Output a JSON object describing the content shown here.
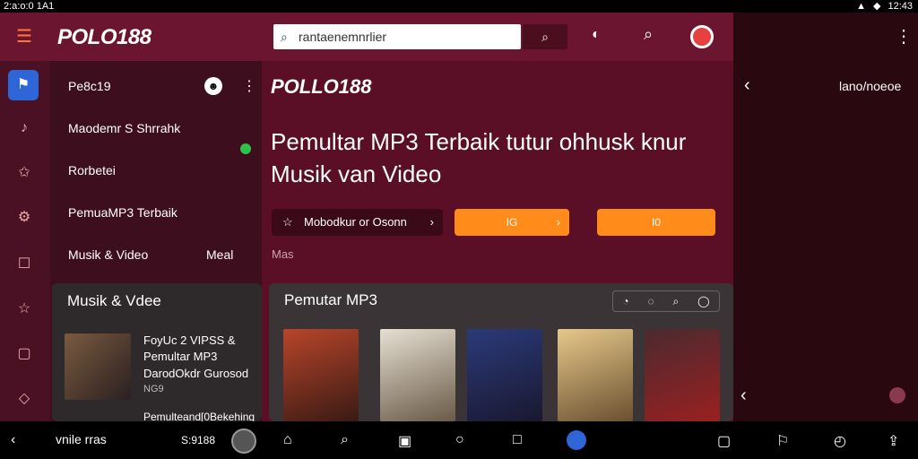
{
  "status": {
    "time_left": "2:a:o:0 1A1",
    "time_right": "12:43"
  },
  "app": {
    "logo": "POLO188",
    "search_placeholder": "rantaenemnrlier"
  },
  "drawer": {
    "items": [
      {
        "label": "Pe8c19"
      },
      {
        "label": "Maodemr S Shrrahk"
      },
      {
        "label": "Rorbetei"
      },
      {
        "label": "PemuaMP3 Terbaik"
      },
      {
        "label": "Musik & Video"
      }
    ],
    "item5_right": "Meal",
    "card_title": "Musik & Vdee",
    "track_line1": "FoyUc 2 VIPSS &",
    "track_line2": "Pemultar MP3",
    "track_line3": "DarodOkdr Gurosod",
    "track_line4": "NG9",
    "track_line5": "Pemulteand[0Bekehing"
  },
  "main": {
    "hero_logo": "POLLO188",
    "hero_title_line1": "Pemultar MP3 Terbaik tutur ohhusk knur",
    "hero_title_line2": "Musik van Video",
    "btn_download": "Mobodkur or Osonn",
    "btn_play": "IG",
    "btn_more": "I0",
    "hint": "Mas",
    "card_title": "Pemutar MP3"
  },
  "rightpanel": {
    "label": "lano/noeoe"
  },
  "bottom": {
    "left_text": "vnile rras",
    "mid_text": "S:9188"
  },
  "icons": {
    "menu": "menu-icon",
    "search": "search-icon",
    "cast": "cast-icon",
    "more": "more-vert-icon",
    "home": "home-icon",
    "music": "music-icon",
    "star": "star-icon",
    "settings": "settings-icon",
    "back": "back-icon",
    "tag": "tag-icon"
  },
  "colors": {
    "accent": "#ff8c1a",
    "brand": "#6b1530",
    "rail_active": "#2e66d8",
    "online": "#2ec24a"
  }
}
